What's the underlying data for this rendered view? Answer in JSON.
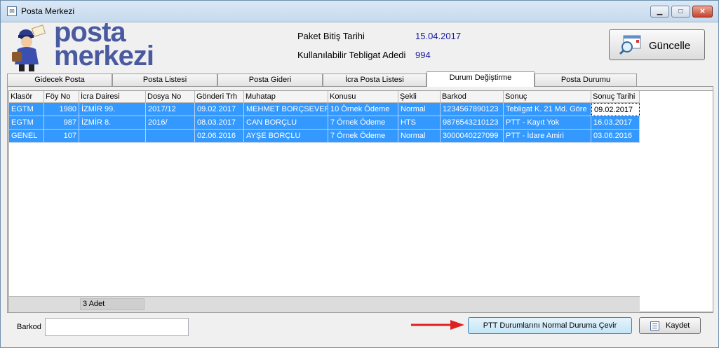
{
  "window": {
    "title": "Posta Merkezi",
    "controls": {
      "minimize": "▁",
      "maximize": "□",
      "close": "✕"
    }
  },
  "logo": {
    "line1": "posta",
    "line2": "merkezi"
  },
  "info": {
    "paket_label": "Paket Bitiş Tarihi",
    "paket_value": "15.04.2017",
    "adet_label": "Kullanılabilir Tebligat Adedi",
    "adet_value": "994"
  },
  "update_button": {
    "label": "Güncelle",
    "icon": "search-window-icon"
  },
  "tabs": [
    "Gidecek Posta",
    "Posta Listesi",
    "Posta Gideri",
    "İcra Posta Listesi",
    "Durum Değiştirme",
    "Posta Durumu"
  ],
  "active_tab": "Durum Değiştirme",
  "table": {
    "columns": [
      "Klasör",
      "Föy No",
      "İcra Dairesi",
      "Dosya No",
      "Gönderi Trh",
      "Muhatap",
      "Konusu",
      "Şekli",
      "Barkod",
      "Sonuç",
      "Sonuç Tarihi"
    ],
    "rows": [
      [
        "EGTM",
        "1980",
        "İZMİR 99.",
        "2017/12",
        "09.02.2017",
        "MEHMET BORÇSEVER",
        "10 Örnek Ödeme",
        "Normal",
        "1234567890123",
        "Tebligat K. 21 Md. Göre",
        "09.02.2017"
      ],
      [
        "EGTM",
        "987",
        "İZMİR 8.",
        "2016/",
        "08.03.2017",
        "CAN BORÇLU",
        "7 Örnek Ödeme",
        "HTS",
        "9876543210123",
        "PTT - Kayıt Yok",
        "16.03.2017"
      ],
      [
        "GENEL",
        "107",
        "",
        "",
        "02.06.2016",
        "AYŞE BORÇLU",
        "7 Örnek Ödeme",
        "Normal",
        "3000040227099",
        "PTT - İdare Amiri",
        "03.06.2016"
      ]
    ],
    "footer_count": "3 Adet"
  },
  "barkod": {
    "label": "Barkod",
    "value": "",
    "placeholder": ""
  },
  "ptt_button": {
    "label": "PTT Durumlarını Normal Duruma Çevir"
  },
  "save_button": {
    "label": "Kaydet",
    "icon": "list-icon"
  },
  "colors": {
    "selection": "#3399ff",
    "logo": "#4a5aa0",
    "value_text": "#1a1aa0",
    "arrow": "#e02020"
  }
}
